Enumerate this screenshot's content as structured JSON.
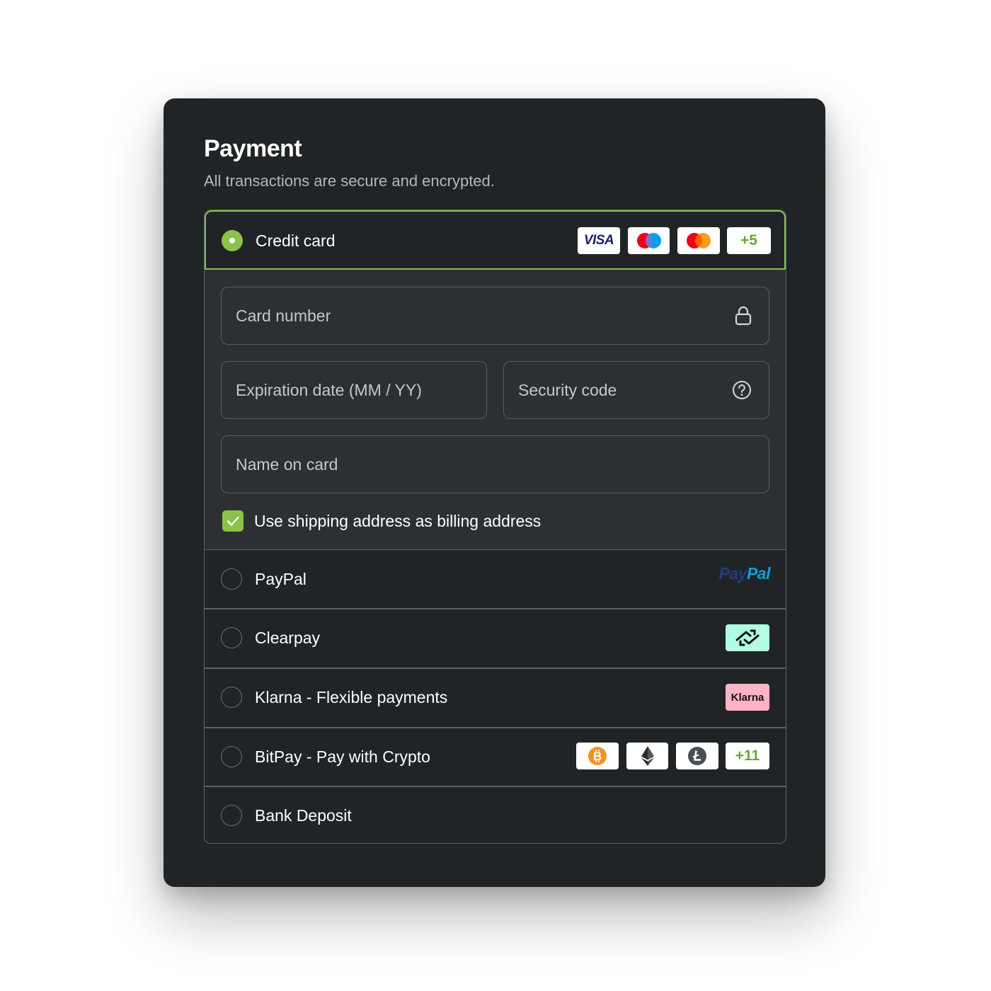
{
  "header": {
    "title": "Payment",
    "subtitle": "All transactions are secure and encrypted."
  },
  "credit_card": {
    "label": "Credit card",
    "selected": true,
    "brands": [
      "visa-logo",
      "maestro-logo",
      "mastercard-logo"
    ],
    "visa_text": "VISA",
    "more_brands": "+5",
    "fields": {
      "card_number": "Card number",
      "expiration": "Expiration date (MM / YY)",
      "security_code": "Security code",
      "name_on_card": "Name on card"
    },
    "billing_checkbox": {
      "label": "Use shipping address as billing address",
      "checked": true
    }
  },
  "methods": [
    {
      "label": "PayPal",
      "logo_text_1": "Pay",
      "logo_text_2": "Pal"
    },
    {
      "label": "Clearpay",
      "logo": "clearpay-logo"
    },
    {
      "label": "Klarna - Flexible payments",
      "logo_text": "Klarna"
    },
    {
      "label": "BitPay - Pay with Crypto",
      "coins": [
        "bitcoin-icon",
        "ethereum-icon",
        "litecoin-icon"
      ],
      "more": "+11"
    },
    {
      "label": "Bank Deposit"
    }
  ],
  "colors": {
    "accent": "#8bc34a",
    "card_bg": "#202426",
    "panel_bg": "#2c3032",
    "clearpay_bg": "#b2fce4",
    "klarna_bg": "#ffb3c7"
  }
}
